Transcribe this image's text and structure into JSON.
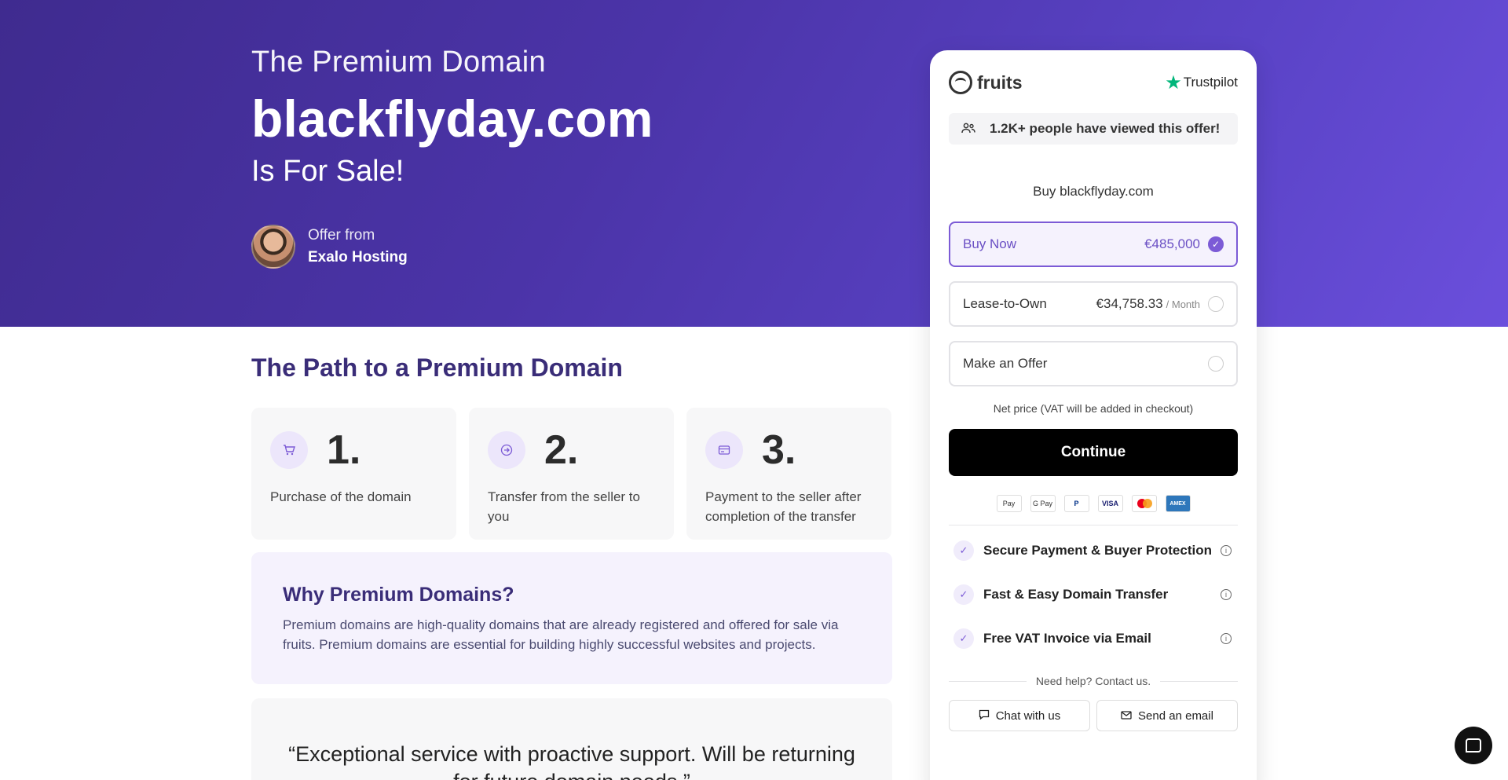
{
  "hero": {
    "pre_title": "The Premium Domain",
    "domain": "blackflyday.com",
    "post_title": "Is For Sale!",
    "seller_label": "Offer from",
    "seller_name": "Exalo Hosting"
  },
  "path": {
    "title": "The Path to a Premium Domain",
    "steps": [
      {
        "number": "1.",
        "text": "Purchase of the domain",
        "icon": "cart-icon"
      },
      {
        "number": "2.",
        "text": "Transfer from the seller to you",
        "icon": "arrow-circle-icon"
      },
      {
        "number": "3.",
        "text": "Payment to the seller after completion of the transfer",
        "icon": "card-icon"
      }
    ]
  },
  "why": {
    "title": "Why Premium Domains?",
    "text": "Premium domains are high-quality domains that are already registered and offered for sale via fruits. Premium domains are essential for building highly successful websites and projects."
  },
  "quote": {
    "text": "“Exceptional service with proactive support. Will be returning for future domain needs.”"
  },
  "card": {
    "brand": "fruits",
    "trustpilot": "Trustpilot",
    "viewers": "1.2K+ people have viewed this offer!",
    "buy_title": "Buy blackflyday.com",
    "options": [
      {
        "label": "Buy Now",
        "price": "€485,000",
        "unit": "",
        "selected": true
      },
      {
        "label": "Lease-to-Own",
        "price": "€34,758.33",
        "unit": "/ Month",
        "selected": false
      },
      {
        "label": "Make an Offer",
        "price": "",
        "unit": "",
        "selected": false
      }
    ],
    "net_price": "Net price (VAT will be added in checkout)",
    "continue": "Continue",
    "payments": [
      "Apple Pay",
      "G Pay",
      "PayPal",
      "VISA",
      "Mastercard",
      "AMEX"
    ],
    "payment_labels": {
      "apple": "Pay",
      "gpay": "G Pay",
      "paypal": "P",
      "visa": "VISA",
      "amex": "AMEX"
    },
    "features": [
      "Secure Payment & Buyer Protection",
      "Fast & Easy Domain Transfer",
      "Free VAT Invoice via Email"
    ],
    "help": "Need help? Contact us.",
    "chat": "Chat with us",
    "email": "Send an email"
  },
  "colors": {
    "accent": "#7c5bd6",
    "hero_start": "#3f2b8f",
    "hero_end": "#6b4fdc"
  }
}
